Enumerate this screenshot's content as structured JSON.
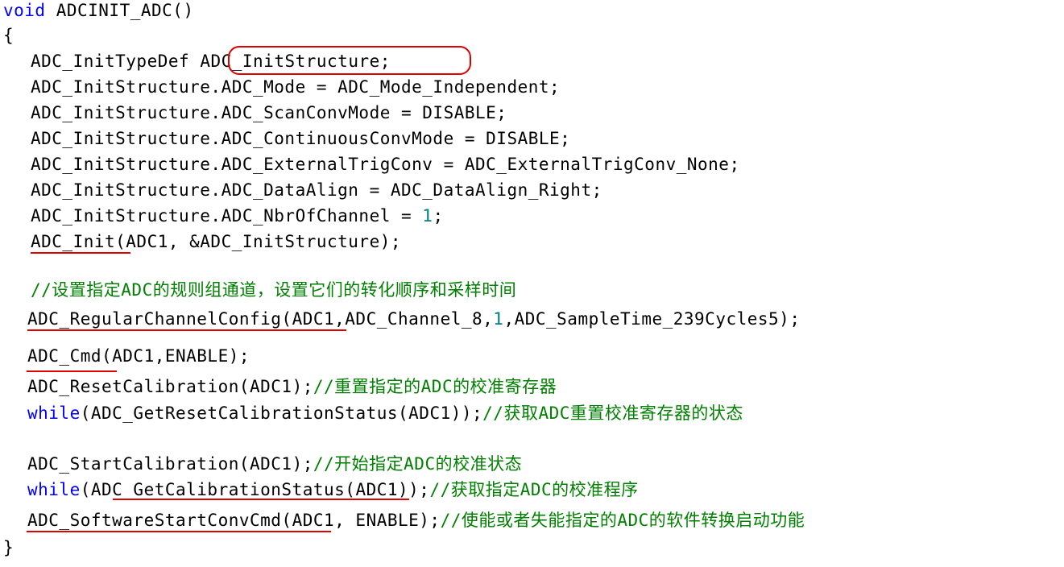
{
  "code": {
    "l1_kw": "void",
    "l1_rest": " ADCINIT_ADC()",
    "l2": "{",
    "l3a": "ADC_InitTypeDef",
    "l3b": "ADC_InitStructure;",
    "l4": "ADC_InitStructure.ADC_Mode = ADC_Mode_Independent;",
    "l5": "ADC_InitStructure.ADC_ScanConvMode = DISABLE;",
    "l6": "ADC_InitStructure.ADC_ContinuousConvMode = DISABLE;",
    "l7": "ADC_InitStructure.ADC_ExternalTrigConv = ADC_ExternalTrigConv_None;",
    "l8": "ADC_InitStructure.ADC_DataAlign = ADC_DataAlign_Right;",
    "l9a": "ADC_InitStructure.ADC_NbrOfChannel = ",
    "l9n": "1",
    "l9b": ";",
    "l10": "ADC_Init(ADC1, &ADC_InitStructure);",
    "l11_comment": "//设置指定ADC的规则组通道，设置它们的转化顺序和采样时间",
    "l12a": "ADC_RegularChannelConfig(ADC1,ADC_Channel_8,",
    "l12n": "1",
    "l12b": ",ADC_SampleTime_239Cycles5);",
    "l13": "ADC_Cmd(ADC1,ENABLE);",
    "l14a": "ADC_ResetCalibration(ADC1);",
    "l14c": "//重置指定的ADC的校准寄存器",
    "l15_kw": "while",
    "l15a": "(ADC_GetResetCalibrationStatus(ADC1));",
    "l15c": "//获取ADC重置校准寄存器的状态",
    "l16a": "ADC_StartCalibration(ADC1);",
    "l16c": "//开始指定ADC的校准状态",
    "l17_kw": "while",
    "l17a": "(ADC_GetCalibrationStatus(ADC1));",
    "l17c": "//获取指定ADC的校准程序",
    "l18a": "ADC_SoftwareStartConvCmd(ADC1, ENABLE);",
    "l18c": "//使能或者失能指定的ADC的软件转换启动功能",
    "l19": "}"
  },
  "colors": {
    "keyword": "#0000ff",
    "number": "#008080",
    "comment": "#008000",
    "annotation": "#e00000"
  }
}
